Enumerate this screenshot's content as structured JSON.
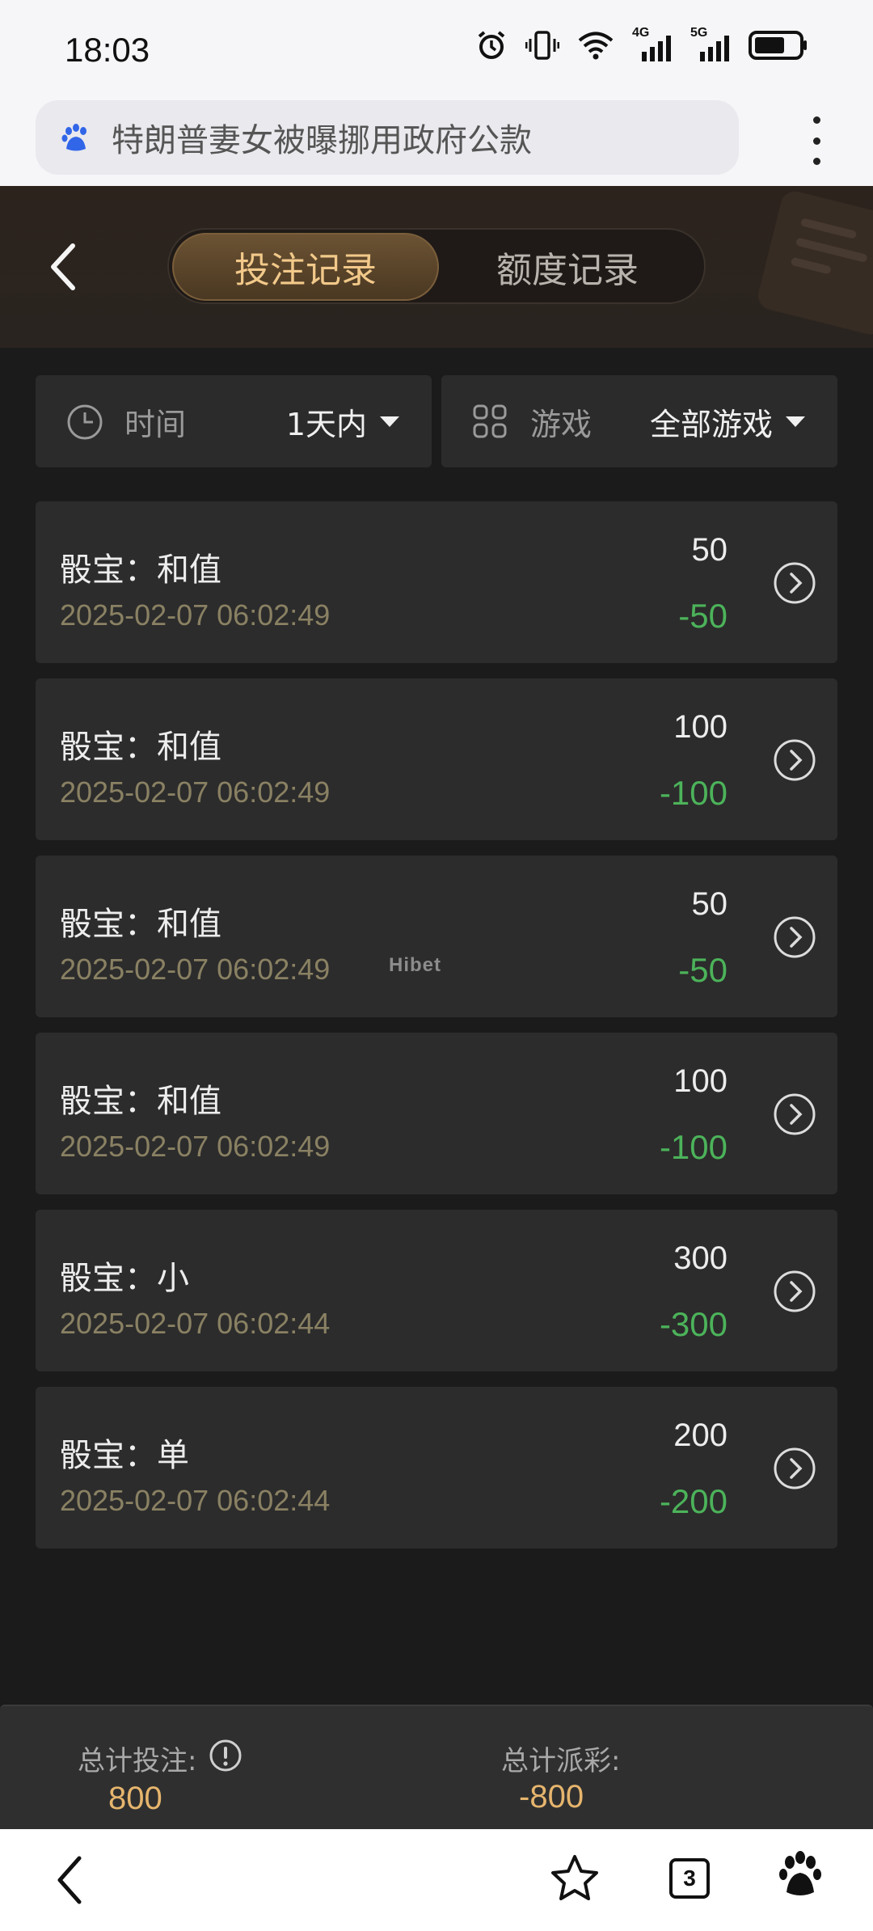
{
  "status_bar": {
    "time": "18:03",
    "network_1": "4G",
    "network_2": "5G"
  },
  "browser": {
    "url_text": "特朗普妻女被曝挪用政府公款",
    "tab_count": "3"
  },
  "header": {
    "tabs": [
      {
        "label": "投注记录",
        "active": true
      },
      {
        "label": "额度记录",
        "active": false
      }
    ]
  },
  "filters": {
    "time": {
      "label": "时间",
      "value": "1天内"
    },
    "game": {
      "label": "游戏",
      "value": "全部游戏"
    }
  },
  "records": [
    {
      "title": "骰宝：和值",
      "time": "2025-02-07 06:02:49",
      "bet": "50",
      "payout": "-50"
    },
    {
      "title": "骰宝：和值",
      "time": "2025-02-07 06:02:49",
      "bet": "100",
      "payout": "-100"
    },
    {
      "title": "骰宝：和值",
      "time": "2025-02-07 06:02:49",
      "bet": "50",
      "payout": "-50"
    },
    {
      "title": "骰宝：和值",
      "time": "2025-02-07 06:02:49",
      "bet": "100",
      "payout": "-100"
    },
    {
      "title": "骰宝：小",
      "time": "2025-02-07 06:02:44",
      "bet": "300",
      "payout": "-300"
    },
    {
      "title": "骰宝：单",
      "time": "2025-02-07 06:02:44",
      "bet": "200",
      "payout": "-200"
    }
  ],
  "watermark": "Hibet",
  "totals": {
    "bet_label": "总计投注:",
    "bet_value": "800",
    "payout_label": "总计派彩:",
    "payout_value": "-800"
  },
  "colors": {
    "accent_gold": "#f2c98a",
    "payout_green": "#4cb35a",
    "background": "#1b1b1b"
  }
}
